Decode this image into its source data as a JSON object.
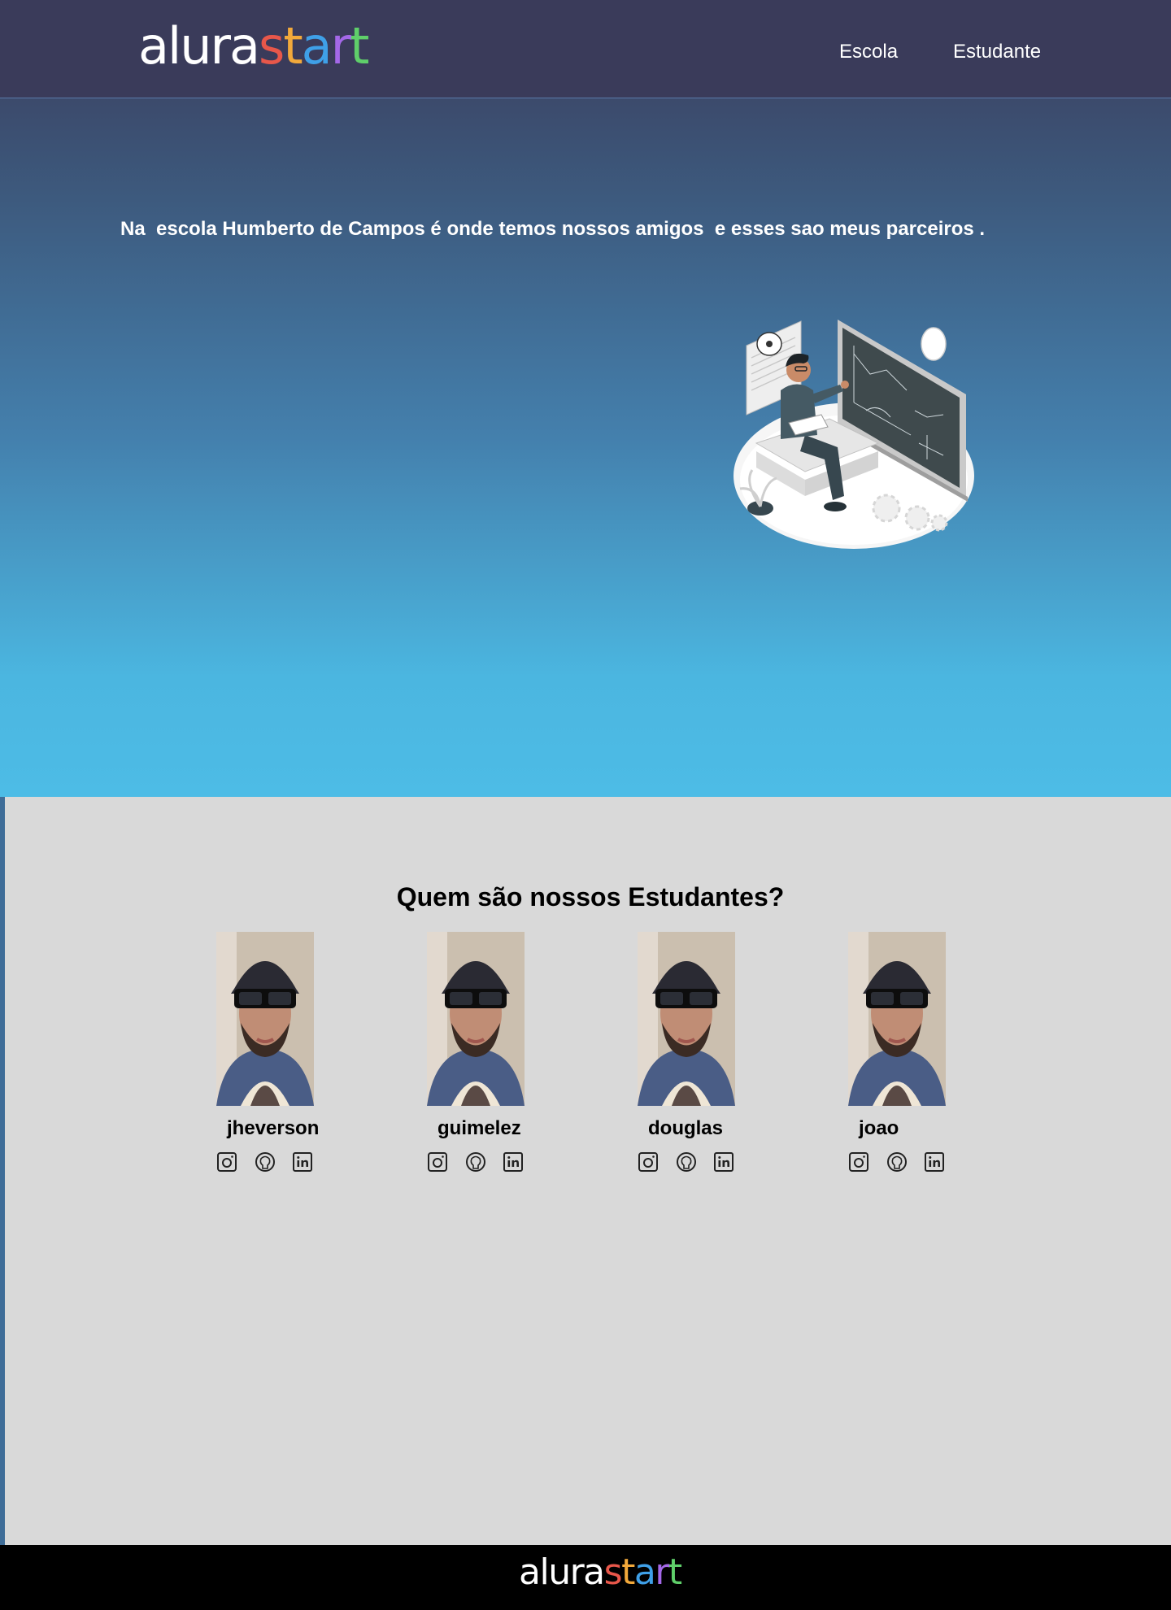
{
  "header": {
    "logo": {
      "part1": "alura",
      "part2": [
        "s",
        "t",
        "a",
        "r",
        "t"
      ],
      "part2_colors": [
        "#e8574a",
        "#f2a93b",
        "#3fa0e8",
        "#a468e8",
        "#5fcf6a"
      ]
    },
    "nav": [
      {
        "label": "Escola"
      },
      {
        "label": "Estudante"
      }
    ]
  },
  "hero": {
    "text": "Na  escola Humberto de Campos é onde temos nossos amigos  e esses sao meus parceiros ."
  },
  "students": {
    "title": "Quem são nossos Estudantes?",
    "items": [
      {
        "name": "jheverson"
      },
      {
        "name": "guimelez"
      },
      {
        "name": "douglas"
      },
      {
        "name": "joao"
      }
    ],
    "social_icons": [
      "instagram-icon",
      "github-icon",
      "linkedin-icon"
    ]
  },
  "footer": {
    "logo": {
      "part1": "alura",
      "part2": [
        "s",
        "t",
        "a",
        "r",
        "t"
      ]
    }
  },
  "colors": {
    "topbar": "#3a3b5a",
    "hero_bottom": "#4dbce6",
    "section_bg": "#d9d9d9",
    "footer_bg": "#000000"
  }
}
